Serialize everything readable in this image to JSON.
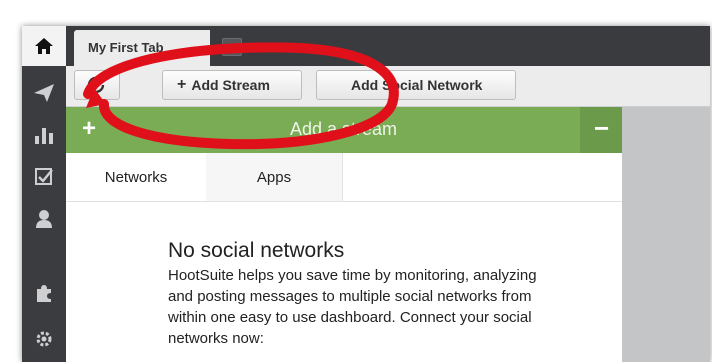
{
  "tab": {
    "label": "My First Tab"
  },
  "toolbar": {
    "add_stream_label": "Add Stream",
    "add_network_label": "Add Social Network"
  },
  "panel": {
    "title": "Add a stream",
    "tabs": [
      {
        "label": "Networks"
      },
      {
        "label": "Apps"
      }
    ],
    "empty_title": "No social networks",
    "empty_desc": "HootSuite helps you save time by monitoring, analyzing and posting messages to multiple social networks from within one easy to use dashboard. Connect your social networks now:"
  },
  "sidebar": {
    "items": [
      "home-icon",
      "send-icon",
      "analytics-icon",
      "assignments-icon",
      "contacts-icon",
      "apps-icon",
      "settings-icon"
    ]
  },
  "colors": {
    "header_green": "#7aac56",
    "sidebar_dark": "#3b3c40",
    "annotation_red": "#e0101a"
  }
}
